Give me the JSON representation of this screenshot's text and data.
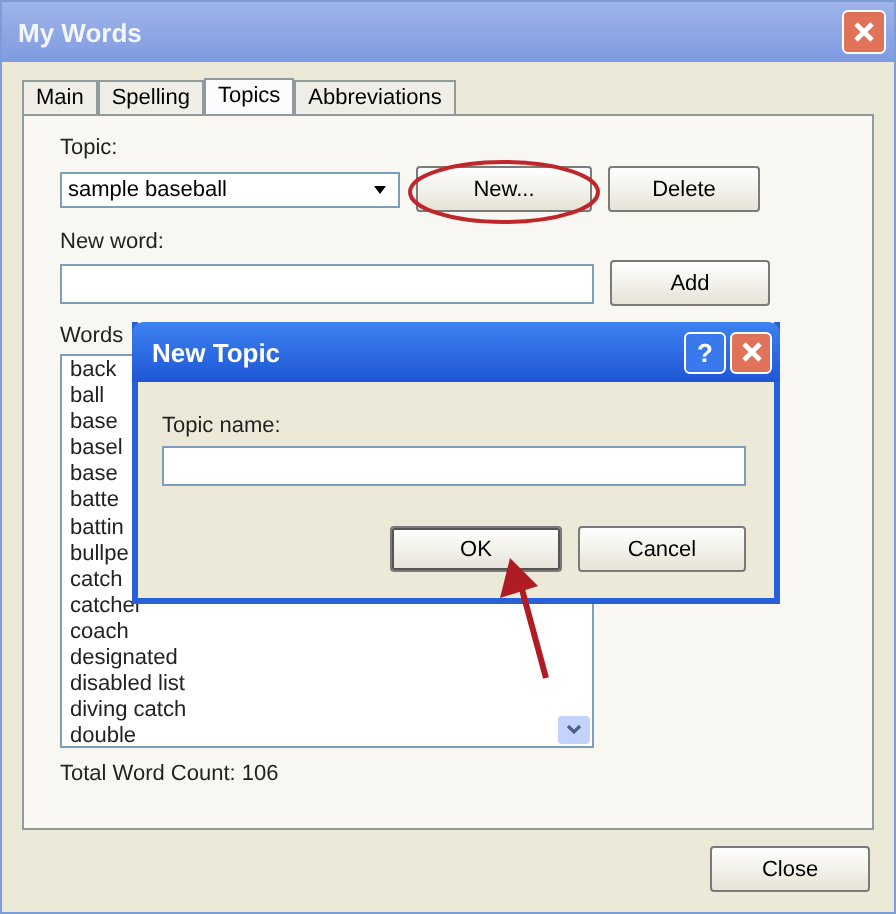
{
  "window": {
    "title": "My Words"
  },
  "tabs": [
    {
      "label": "Main",
      "selected": false
    },
    {
      "label": "Spelling",
      "selected": false
    },
    {
      "label": "Topics",
      "selected": true
    },
    {
      "label": "Abbreviations",
      "selected": false
    }
  ],
  "topic": {
    "label": "Topic:",
    "value": "sample baseball",
    "buttons": [
      "New...",
      "Delete"
    ]
  },
  "new_word": {
    "label": "New word:",
    "button": "Add"
  },
  "words": {
    "label": "Words",
    "items": [
      "back",
      "ball",
      "base",
      "basel",
      "base",
      "batte",
      "battin",
      "bullpe",
      "catch",
      "catcher",
      "coach",
      "designated",
      "disabled list",
      "diving catch",
      "double"
    ]
  },
  "total": "Total Word Count: 106",
  "close_button": "Close",
  "dialog": {
    "title": "New Topic",
    "help": "?",
    "label": "Topic name:",
    "buttons": [
      "OK",
      "Cancel"
    ]
  }
}
